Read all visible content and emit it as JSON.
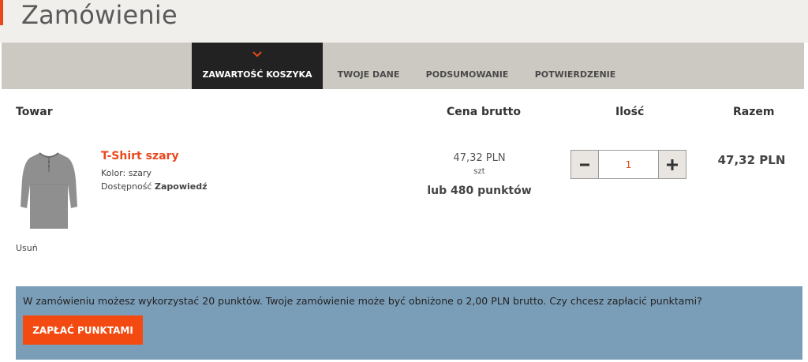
{
  "header": {
    "title": "Zamówienie",
    "accent_color": "#e8481c"
  },
  "steps": [
    {
      "label": "ZAWARTOŚĆ KOSZYKA",
      "active": true,
      "icon": "chevron-down-icon"
    },
    {
      "label": "TWOJE DANE",
      "active": false
    },
    {
      "label": "PODSUMOWANIE",
      "active": false
    },
    {
      "label": "POTWIERDZENIE",
      "active": false
    }
  ],
  "table": {
    "headers": {
      "product": "Towar",
      "price": "Cena brutto",
      "quantity": "Ilość",
      "total": "Razem"
    }
  },
  "item": {
    "name": "T-Shirt szary",
    "color_label": "Kolor:",
    "color_value": "szary",
    "availability_label": "Dostępność",
    "availability_value": "Zapowiedź",
    "price": "47,32 PLN",
    "unit": "szt",
    "points_price": "lub 480 punktów",
    "quantity": "1",
    "minus_icon": "minus-icon",
    "plus_icon": "plus-icon",
    "total": "47,32 PLN",
    "remove_label": "Usuń",
    "image_icon": "tshirt-image"
  },
  "points": {
    "message": "W zamówieniu możesz wykorzystać 20 punktów. Twoje zamówienie może być obniżone o 2,00 PLN brutto. Czy chcesz zapłacić punktami?",
    "button_label": "ZAPŁAĆ PUNKTAMI",
    "box_color": "#7b9eb8",
    "button_color": "#f24a10"
  }
}
